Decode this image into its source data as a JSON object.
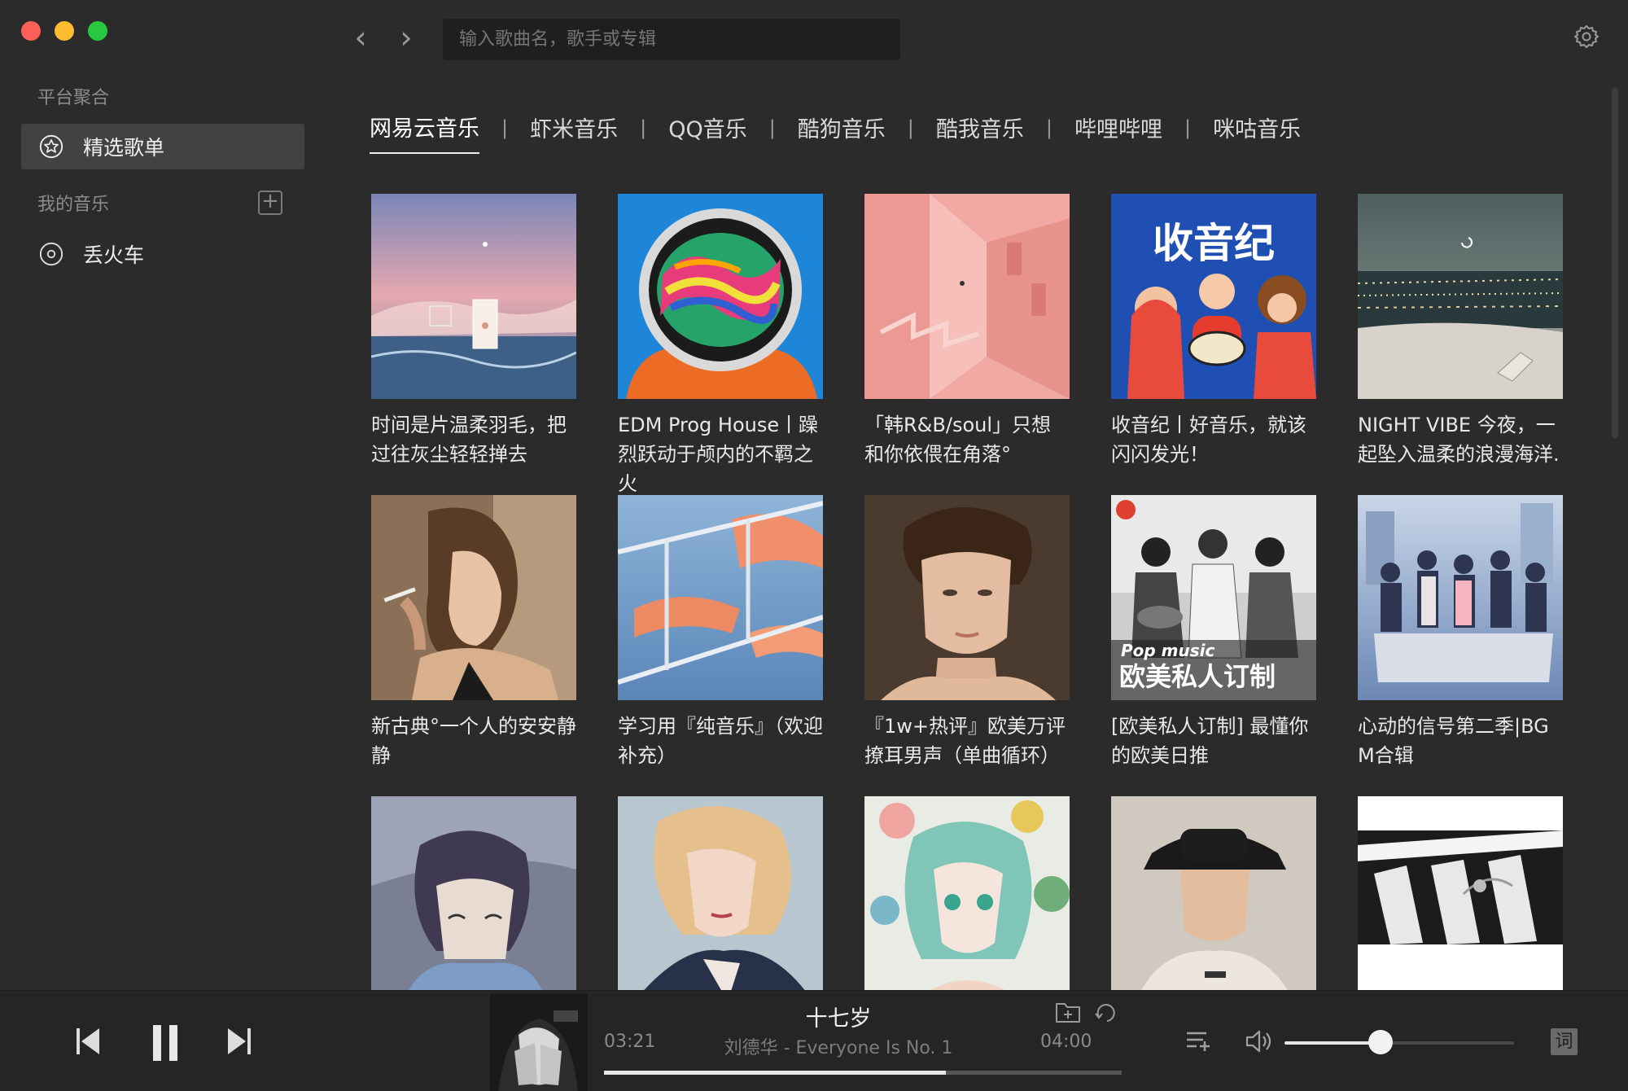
{
  "titlebar": {
    "search_placeholder": "输入歌曲名，歌手或专辑"
  },
  "sidebar": {
    "section_platform": "平台聚合",
    "featured_label": "精选歌单",
    "section_my_music": "我的音乐",
    "add_symbol": "+",
    "lost_train_label": "丢火车"
  },
  "tabs": [
    {
      "label": "网易云音乐",
      "active": true
    },
    {
      "label": "虾米音乐",
      "active": false
    },
    {
      "label": "QQ音乐",
      "active": false
    },
    {
      "label": "酷狗音乐",
      "active": false
    },
    {
      "label": "酷我音乐",
      "active": false
    },
    {
      "label": "哔哩哔哩",
      "active": false
    },
    {
      "label": "咪咕音乐",
      "active": false
    }
  ],
  "tab_separator": "|",
  "playlists": [
    {
      "title": "时间是片温柔羽毛，把过往灰尘轻轻掸去"
    },
    {
      "title": "EDM Prog House丨躁烈跃动于颅内的不羁之火"
    },
    {
      "title": "「韩R&B/soul」只想和你依偎在角落°"
    },
    {
      "title": "收音纪丨好音乐，就该闪闪发光！"
    },
    {
      "title": "NIGHT VIBE 今夜，一起坠入温柔的浪漫海洋."
    },
    {
      "title": "新古典°一个人的安安静静"
    },
    {
      "title": "学习用『纯音乐』（欢迎补充）"
    },
    {
      "title": "『1w+热评』欧美万评撩耳男声（单曲循环）"
    },
    {
      "title": "[欧美私人订制] 最懂你的欧美日推"
    },
    {
      "title": "心动的信号第二季|BGM合辑"
    },
    {
      "title": ""
    },
    {
      "title": ""
    },
    {
      "title": ""
    },
    {
      "title": ""
    },
    {
      "title": ""
    }
  ],
  "cover_text": {
    "radio_title": "收音纪",
    "pop_line1": "Pop music",
    "pop_line2": "欧美私人订制"
  },
  "player": {
    "song_title": "十七岁",
    "artist_album": "刘德华 - Everyone Is No. 1",
    "current_time": "03:21",
    "total_time": "04:00",
    "progress_fraction": 0.66,
    "volume_fraction": 0.42,
    "lyric_label": "词"
  },
  "colors": {
    "background": "#2b2b2b",
    "sidebar_active": "#424242",
    "player_bg": "#252525",
    "accent_text": "#ffffff"
  }
}
